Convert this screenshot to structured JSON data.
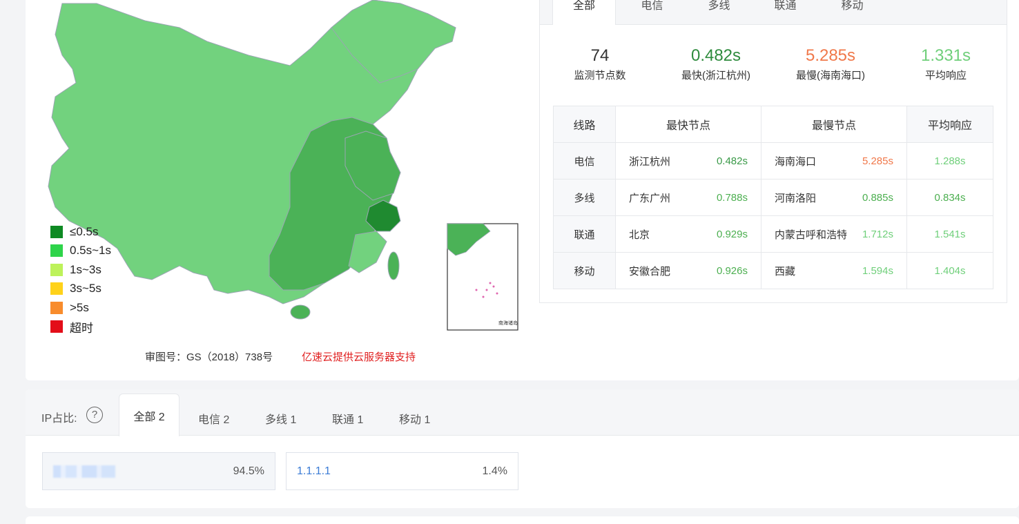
{
  "map": {
    "legend": [
      {
        "label": "≤0.5s",
        "color": "#0e8a23"
      },
      {
        "label": "0.5s~1s",
        "color": "#2ed44a"
      },
      {
        "label": "1s~3s",
        "color": "#bdf25a"
      },
      {
        "label": "3s~5s",
        "color": "#ffd21a"
      },
      {
        "label": ">5s",
        "color": "#f88c2c"
      },
      {
        "label": "超时",
        "color": "#e30e19"
      }
    ],
    "approval": "审图号：GS（2018）738号",
    "sponsor": "亿速云提供云服务器支持",
    "inset_title": "南海诸岛",
    "colors": {
      "base": "#72d27e",
      "mid": "#4bb257",
      "dark": "#1f8a30"
    }
  },
  "line_tabs": [
    "全部",
    "电信",
    "多线",
    "联通",
    "移动"
  ],
  "stats": [
    {
      "value": "74",
      "label": "监测节点数",
      "color": "#333333"
    },
    {
      "value": "0.482s",
      "label": "最快(浙江杭州)",
      "color": "#2e8b3d"
    },
    {
      "value": "5.285s",
      "label": "最慢(海南海口)",
      "color": "#f0784a"
    },
    {
      "value": "1.331s",
      "label": "平均响应",
      "color": "#6fcf7a"
    }
  ],
  "table": {
    "headers": [
      "线路",
      "最快节点",
      "最慢节点",
      "平均响应"
    ],
    "rows": [
      {
        "line": "电信",
        "fast_node": "浙江杭州",
        "fast_time": "0.482s",
        "fast_color": "#3a9a48",
        "slow_node": "海南海口",
        "slow_time": "5.285s",
        "slow_color": "#f0784a",
        "avg": "1.288s",
        "avg_color": "#6fcf7a"
      },
      {
        "line": "多线",
        "fast_node": "广东广州",
        "fast_time": "0.788s",
        "fast_color": "#4caf50",
        "slow_node": "河南洛阳",
        "slow_time": "0.885s",
        "slow_color": "#4caf50",
        "avg": "0.834s",
        "avg_color": "#4caf50"
      },
      {
        "line": "联通",
        "fast_node": "北京",
        "fast_time": "0.929s",
        "fast_color": "#4caf50",
        "slow_node": "内蒙古呼和浩特",
        "slow_time": "1.712s",
        "slow_color": "#6fcf7a",
        "avg": "1.541s",
        "avg_color": "#6fcf7a"
      },
      {
        "line": "移动",
        "fast_node": "安徽合肥",
        "fast_time": "0.926s",
        "fast_color": "#4caf50",
        "slow_node": "西藏",
        "slow_time": "1.594s",
        "slow_color": "#6fcf7a",
        "avg": "1.404s",
        "avg_color": "#6fcf7a"
      }
    ]
  },
  "ip": {
    "label": "IP占比:",
    "help_icon": "question-icon",
    "tabs": [
      "全部 2",
      "电信 2",
      "多线 1",
      "联通 1",
      "移动 1"
    ],
    "entries": [
      {
        "ip": "",
        "percent": "94.5%",
        "blurred": true
      },
      {
        "ip": "1.1.1.1",
        "percent": "1.4%",
        "blurred": false
      }
    ]
  }
}
